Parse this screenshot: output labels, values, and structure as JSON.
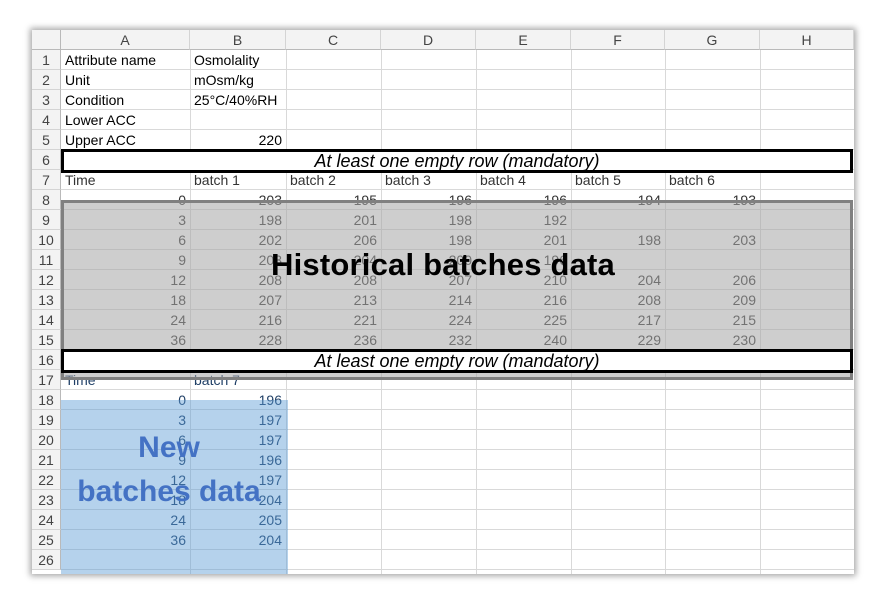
{
  "columns": [
    "A",
    "B",
    "C",
    "D",
    "E",
    "F",
    "G",
    "H"
  ],
  "rows": [
    "1",
    "2",
    "3",
    "4",
    "5",
    "6",
    "7",
    "8",
    "9",
    "10",
    "11",
    "12",
    "13",
    "14",
    "15",
    "16",
    "17",
    "18",
    "19",
    "20",
    "21",
    "22",
    "23",
    "24",
    "25",
    "26"
  ],
  "cells": {
    "A1": "Attribute name",
    "B1": "Osmolality",
    "A2": "Unit",
    "B2": "mOsm/kg",
    "A3": "Condition",
    "B3": "25°C/40%RH",
    "A4": "Lower ACC",
    "A5": "Upper ACC",
    "B5": "220",
    "A7": "Time",
    "B7": "batch 1",
    "C7": "batch 2",
    "D7": "batch 3",
    "E7": "batch 4",
    "F7": "batch 5",
    "G7": "batch 6",
    "A8": "0",
    "B8": "203",
    "C8": "195",
    "D8": "196",
    "E8": "196",
    "F8": "194",
    "G8": "193",
    "A9": "3",
    "B9": "198",
    "C9": "201",
    "D9": "198",
    "E9": "192",
    "A10": "6",
    "B10": "202",
    "C10": "206",
    "D10": "198",
    "E10": "201",
    "F10": "198",
    "G10": "203",
    "A11": "9",
    "B11": "203",
    "C11": "204",
    "D11": "200",
    "E11": "196",
    "A12": "12",
    "B12": "208",
    "C12": "208",
    "D12": "207",
    "E12": "210",
    "F12": "204",
    "G12": "206",
    "A13": "18",
    "B13": "207",
    "C13": "213",
    "D13": "214",
    "E13": "216",
    "F13": "208",
    "G13": "209",
    "A14": "24",
    "B14": "216",
    "C14": "221",
    "D14": "224",
    "E14": "225",
    "F14": "217",
    "G14": "215",
    "A15": "36",
    "B15": "228",
    "C15": "236",
    "D15": "232",
    "E15": "240",
    "F15": "229",
    "G15": "230",
    "A17": "Time",
    "B17": "batch 7",
    "A18": "0",
    "B18": "196",
    "A19": "3",
    "B19": "197",
    "A20": "6",
    "B20": "197",
    "A21": "9",
    "B21": "196",
    "A22": "12",
    "B22": "197",
    "A23": "18",
    "B23": "204",
    "A24": "24",
    "B24": "205",
    "A25": "36",
    "B25": "204"
  },
  "annotations": {
    "empty_row_top": "At least one empty row (mandatory)",
    "empty_row_bottom": "At least one empty row (mandatory)",
    "historical": "Historical batches data",
    "new_line1": "New",
    "new_line2": "batches data"
  },
  "colors": {
    "historical_fill": "#a6a6a6",
    "new_fill": "#5b9bd5",
    "new_text": "#4472c4"
  }
}
